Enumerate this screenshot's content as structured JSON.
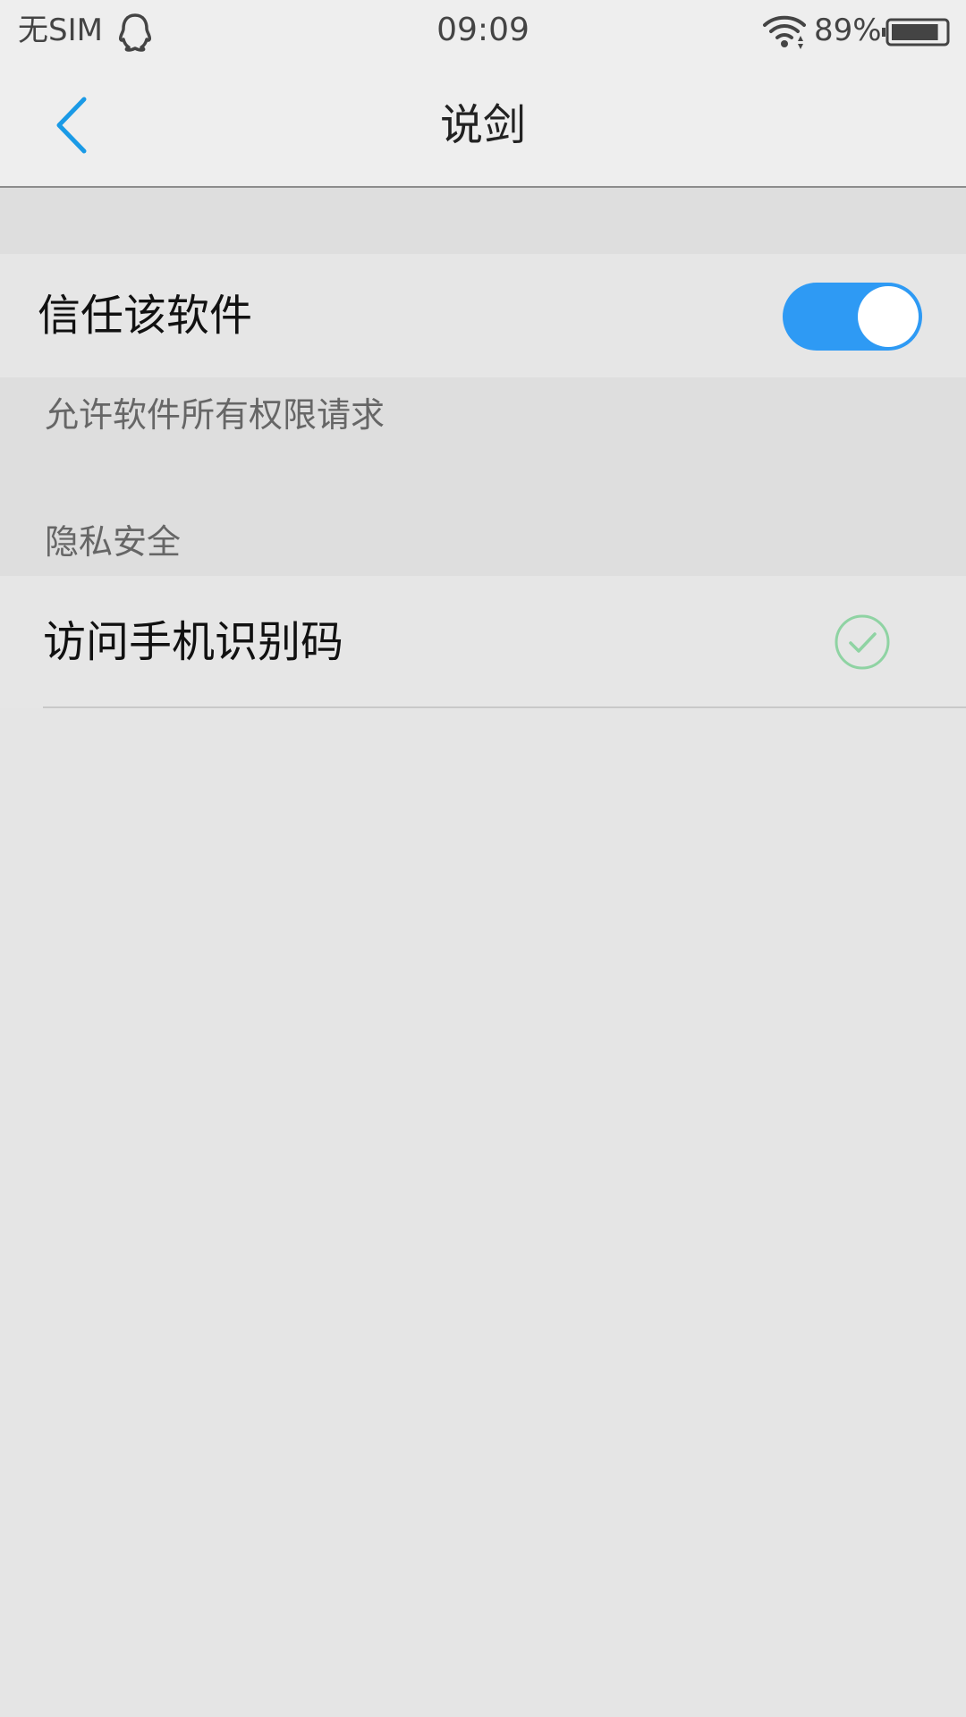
{
  "status_bar": {
    "carrier": "无SIM",
    "time": "09:09",
    "battery": "89%",
    "battery_level": 0.89,
    "icons": [
      "qq-icon",
      "wifi-icon",
      "battery-icon"
    ]
  },
  "nav": {
    "title": "说剑",
    "back_icon": "chevron-left-icon"
  },
  "trust": {
    "label": "信任该软件",
    "enabled": true,
    "description": "允许软件所有权限请求"
  },
  "privacy": {
    "section_title": "隐私安全",
    "items": [
      {
        "label": "访问手机识别码",
        "granted": true,
        "icon": "check-circle-icon"
      }
    ]
  },
  "colors": {
    "accent_blue": "#2e9af4",
    "back_arrow": "#1a9ae6",
    "check_green": "#8fd3a3",
    "background": "#e5e5e5"
  }
}
